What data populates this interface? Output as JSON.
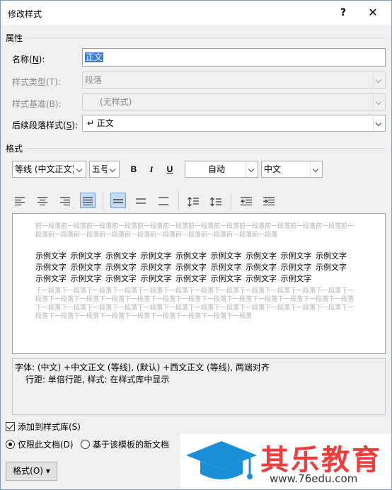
{
  "window": {
    "title": "修改样式",
    "help": "?",
    "close": "✕"
  },
  "properties": {
    "section": "属性",
    "name_label": "名称(N):",
    "name_value": "正文",
    "type_label": "样式类型(T):",
    "type_value": "段落",
    "based_label": "样式基准(B):",
    "based_value": "(无样式)",
    "next_label": "后续段落样式(S):",
    "next_value": "↵ 正文"
  },
  "format": {
    "section": "格式",
    "font": "等线 (中文正文)",
    "size": "五号",
    "bold": "B",
    "italic": "I",
    "underline": "U",
    "color": "自动",
    "language": "中文"
  },
  "preview": {
    "prev_para": "前一段落前一段落前一段落前一段落前一段落前一段落前一段落前一段落前一段落前一段落前一段落前一段落前一段落前一段落前一段落前一段落前一段落前一段落前一段落前一段落前一段落前一段落",
    "sample_lines": [
      "示例文字  示例文字  示例文字  示例文字  示例文字  示例文字  示例文字  示例文字  示例文字",
      "示例文字  示例文字  示例文字  示例文字  示例文字  示例文字  示例文字  示例文字  示例文字",
      "示例文字  示例文字  示例文字  示例文字  示例文字  示例文字  示例文字  示例文字"
    ],
    "next_para": "下一段落下一段落下一段落下一段落下一段落下一段落下一段落下一段落下一段落下一段落下一段落下一段落下一段落下一段落下一段落下一段落下一段落下一段落下一段落下一段落下一段落下一段落下一段落下一段落下一段落下一段落下一段落下一段落下一段落下一段落下一段落下一段落下一段落下一段落下一段落下一段落下一段落下一段落下一段落下一段落下一段落下一段落下一段落下一段落下一段落下一段落"
  },
  "description": {
    "line1": "字体: (中文) +中文正文 (等线), (默认) +西文正文 (等线), 两端对齐",
    "line2": "行距: 单倍行距, 样式: 在样式库中显示"
  },
  "options": {
    "add_to_gallery": "添加到样式库(S)",
    "only_this_doc": "仅限此文档(D)",
    "new_docs": "基于该模板的新文档"
  },
  "buttons": {
    "format": "格式(O) ▾"
  },
  "watermark": {
    "brand": "其乐教育",
    "url": "www.76edu.com"
  }
}
